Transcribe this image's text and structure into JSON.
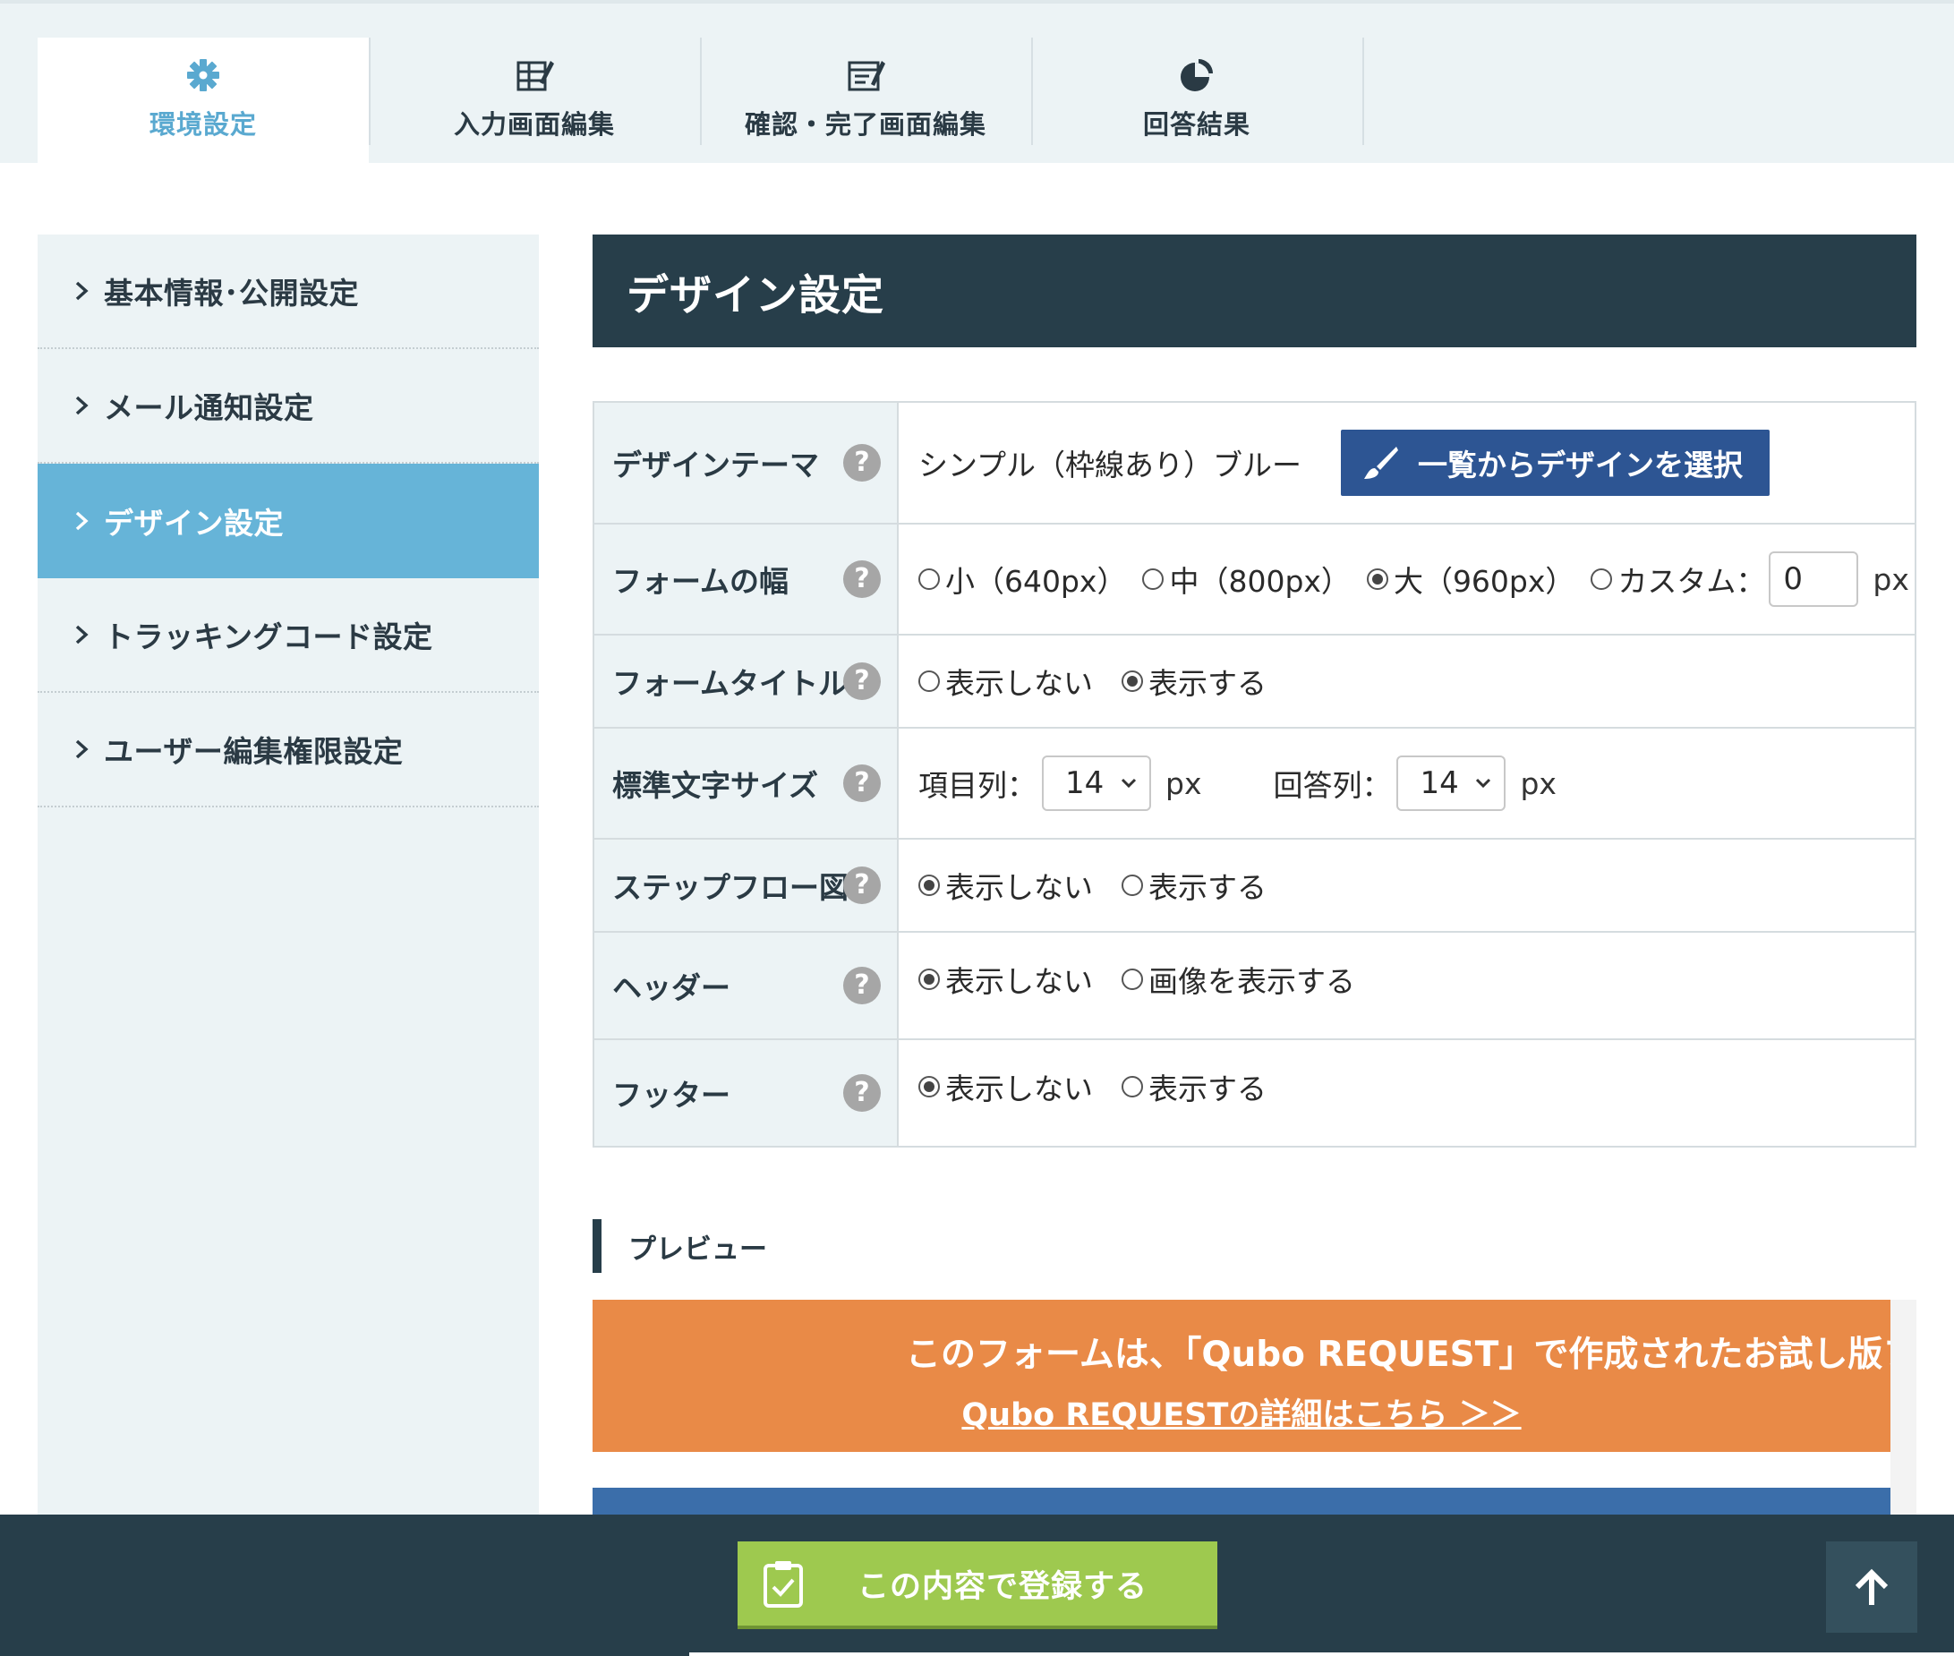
{
  "tabs": [
    {
      "label": "環境設定",
      "icon": "gear-icon",
      "active": true
    },
    {
      "label": "入力画面編集",
      "icon": "table-edit-icon"
    },
    {
      "label": "確認・完了画面編集",
      "icon": "form-edit-icon"
    },
    {
      "label": "回答結果",
      "icon": "pie-chart-icon"
    }
  ],
  "sidebar": {
    "items": [
      {
        "label": "基本情報･公開設定"
      },
      {
        "label": "メール通知設定"
      },
      {
        "label": "デザイン設定",
        "active": true
      },
      {
        "label": "トラッキングコード設定"
      },
      {
        "label": "ユーザー編集権限設定"
      }
    ]
  },
  "main": {
    "title": "デザイン設定",
    "help_symbol": "?",
    "rows": {
      "theme": {
        "label": "デザインテーマ",
        "value": "シンプル（枠線あり）ブルー",
        "button": "一覧からデザインを選択"
      },
      "width": {
        "label": "フォームの幅",
        "options": [
          "小（640px）",
          "中（800px）",
          "大（960px）",
          "カスタム："
        ],
        "selected": 2,
        "custom_value": "0",
        "unit": "px"
      },
      "form_title": {
        "label": "フォームタイトル",
        "options": [
          "表示しない",
          "表示する"
        ],
        "selected": 1
      },
      "font_size": {
        "label": "標準文字サイズ",
        "item_label": "項目列：",
        "item_value": "14",
        "answer_label": "回答列：",
        "answer_value": "14",
        "unit": "px"
      },
      "step_flow": {
        "label": "ステップフロー図",
        "options": [
          "表示しない",
          "表示する"
        ],
        "selected": 0
      },
      "header": {
        "label": "ヘッダー",
        "options": [
          "表示しない",
          "画像を表示する"
        ],
        "selected": 0
      },
      "footer": {
        "label": "フッター",
        "options": [
          "表示しない",
          "表示する"
        ],
        "selected": 0
      }
    }
  },
  "preview": {
    "heading": "プレビュー",
    "banner_text": "このフォームは、「Qubo REQUEST」で作成されたお試し版フォーム",
    "banner_link": "Qubo REQUESTの詳細はこちら ＞＞"
  },
  "footer_bar": {
    "submit_label": "この内容で登録する",
    "to_top_icon": "arrow-up-icon"
  },
  "colors": {
    "accent_tab": "#5aa9d0",
    "sidebar_active": "#66b4d8",
    "title_bar": "#273e4a",
    "design_button": "#2d5593",
    "trial_banner": "#e98a47",
    "submit_button": "#9ec94f"
  }
}
